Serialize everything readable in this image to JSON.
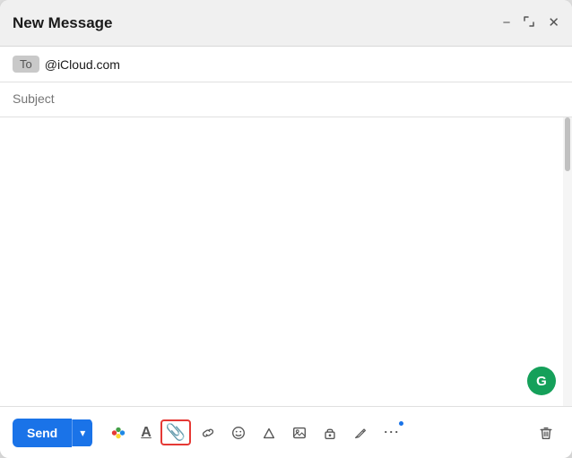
{
  "window": {
    "title": "New Message"
  },
  "titleBar": {
    "title": "New Message",
    "minimizeLabel": "minimize",
    "expandLabel": "expand",
    "closeLabel": "close"
  },
  "toField": {
    "badge": "To",
    "email": "@iCloud.com"
  },
  "subjectField": {
    "placeholder": "Subject",
    "value": ""
  },
  "bodyField": {
    "value": "",
    "placeholder": ""
  },
  "toolbar": {
    "sendLabel": "Send",
    "sendDropdownLabel": "▾",
    "tools": [
      {
        "name": "color-icon",
        "symbol": "🌈"
      },
      {
        "name": "format-text-icon",
        "symbol": "A"
      },
      {
        "name": "attach-icon",
        "symbol": "📎"
      },
      {
        "name": "link-icon",
        "symbol": "🔗"
      },
      {
        "name": "emoji-icon",
        "symbol": "😊"
      },
      {
        "name": "drive-icon",
        "symbol": "△"
      },
      {
        "name": "photo-icon",
        "symbol": "▣"
      },
      {
        "name": "lock-icon",
        "symbol": "🔒"
      },
      {
        "name": "pencil-icon",
        "symbol": "✏️"
      },
      {
        "name": "more-icon",
        "symbol": "⋯"
      },
      {
        "name": "delete-icon",
        "symbol": "🗑"
      }
    ]
  }
}
